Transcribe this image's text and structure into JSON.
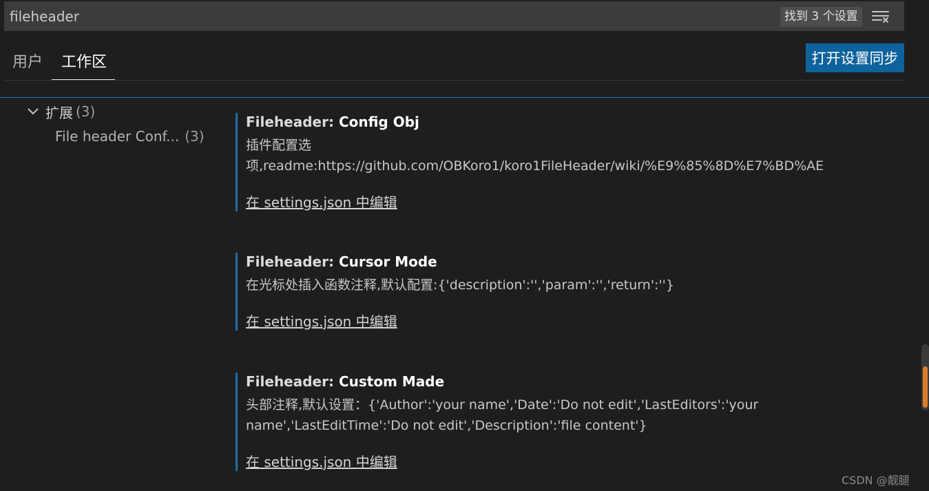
{
  "search": {
    "value": "fileheader",
    "result_count": "找到 3 个设置"
  },
  "tabs": [
    {
      "label": "用户"
    },
    {
      "label": "工作区"
    }
  ],
  "sync_button_label": "打开设置同步",
  "toc": {
    "group": {
      "label": "扩展",
      "count": "(3)"
    },
    "items": [
      {
        "label": "File header Conf...",
        "count": "(3)"
      }
    ]
  },
  "settings": [
    {
      "category": "Fileheader: ",
      "name": "Config Obj",
      "description": "插件配置选项,readme:https://github.com/OBKoro1/koro1FileHeader/wiki/%E9%85%8D%E7%BD%AE",
      "link": "在 settings.json 中编辑"
    },
    {
      "category": "Fileheader: ",
      "name": "Cursor Mode",
      "description": "在光标处插入函数注释,默认配置:{'description':'','param':'','return':''}",
      "link": "在 settings.json 中编辑"
    },
    {
      "category": "Fileheader: ",
      "name": "Custom Made",
      "description": "头部注释,默认设置：{'Author':'your name','Date':'Do not edit','LastEditors':'your name','LastEditTime':'Do not edit','Description':'file content'}",
      "link": "在 settings.json 中编辑"
    }
  ],
  "watermark": "CSDN @靓腿",
  "colors": {
    "accent": "#0e639c",
    "setting_border": "#1f6fa8",
    "scroll_thumb": "#e07b2a"
  },
  "icons": {
    "filter": "filter-lines-icon",
    "chevron": "chevron-down-icon"
  }
}
